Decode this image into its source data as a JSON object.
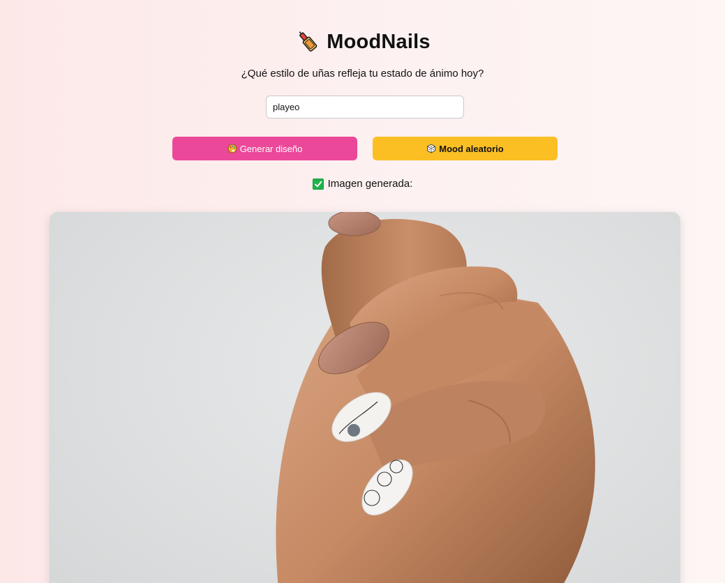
{
  "header": {
    "title": "MoodNails",
    "logo_icon": "nail-polish-icon"
  },
  "subtitle": "¿Qué estilo de uñas refleja tu estado de ánimo hoy?",
  "mood_input": {
    "value": "playeo",
    "placeholder": ""
  },
  "buttons": {
    "generate": {
      "label": "Generar diseño",
      "icon": "palette-icon"
    },
    "random": {
      "label": "Mood aleatorio",
      "icon": "dice-icon"
    }
  },
  "status": {
    "text": "Imagen generada:",
    "icon": "check-icon"
  },
  "image": {
    "alt": "",
    "description_icon": "generated-hand-image"
  },
  "colors": {
    "generate_button": "#ec4899",
    "random_button": "#fbbf24",
    "check": "#22b14c"
  }
}
